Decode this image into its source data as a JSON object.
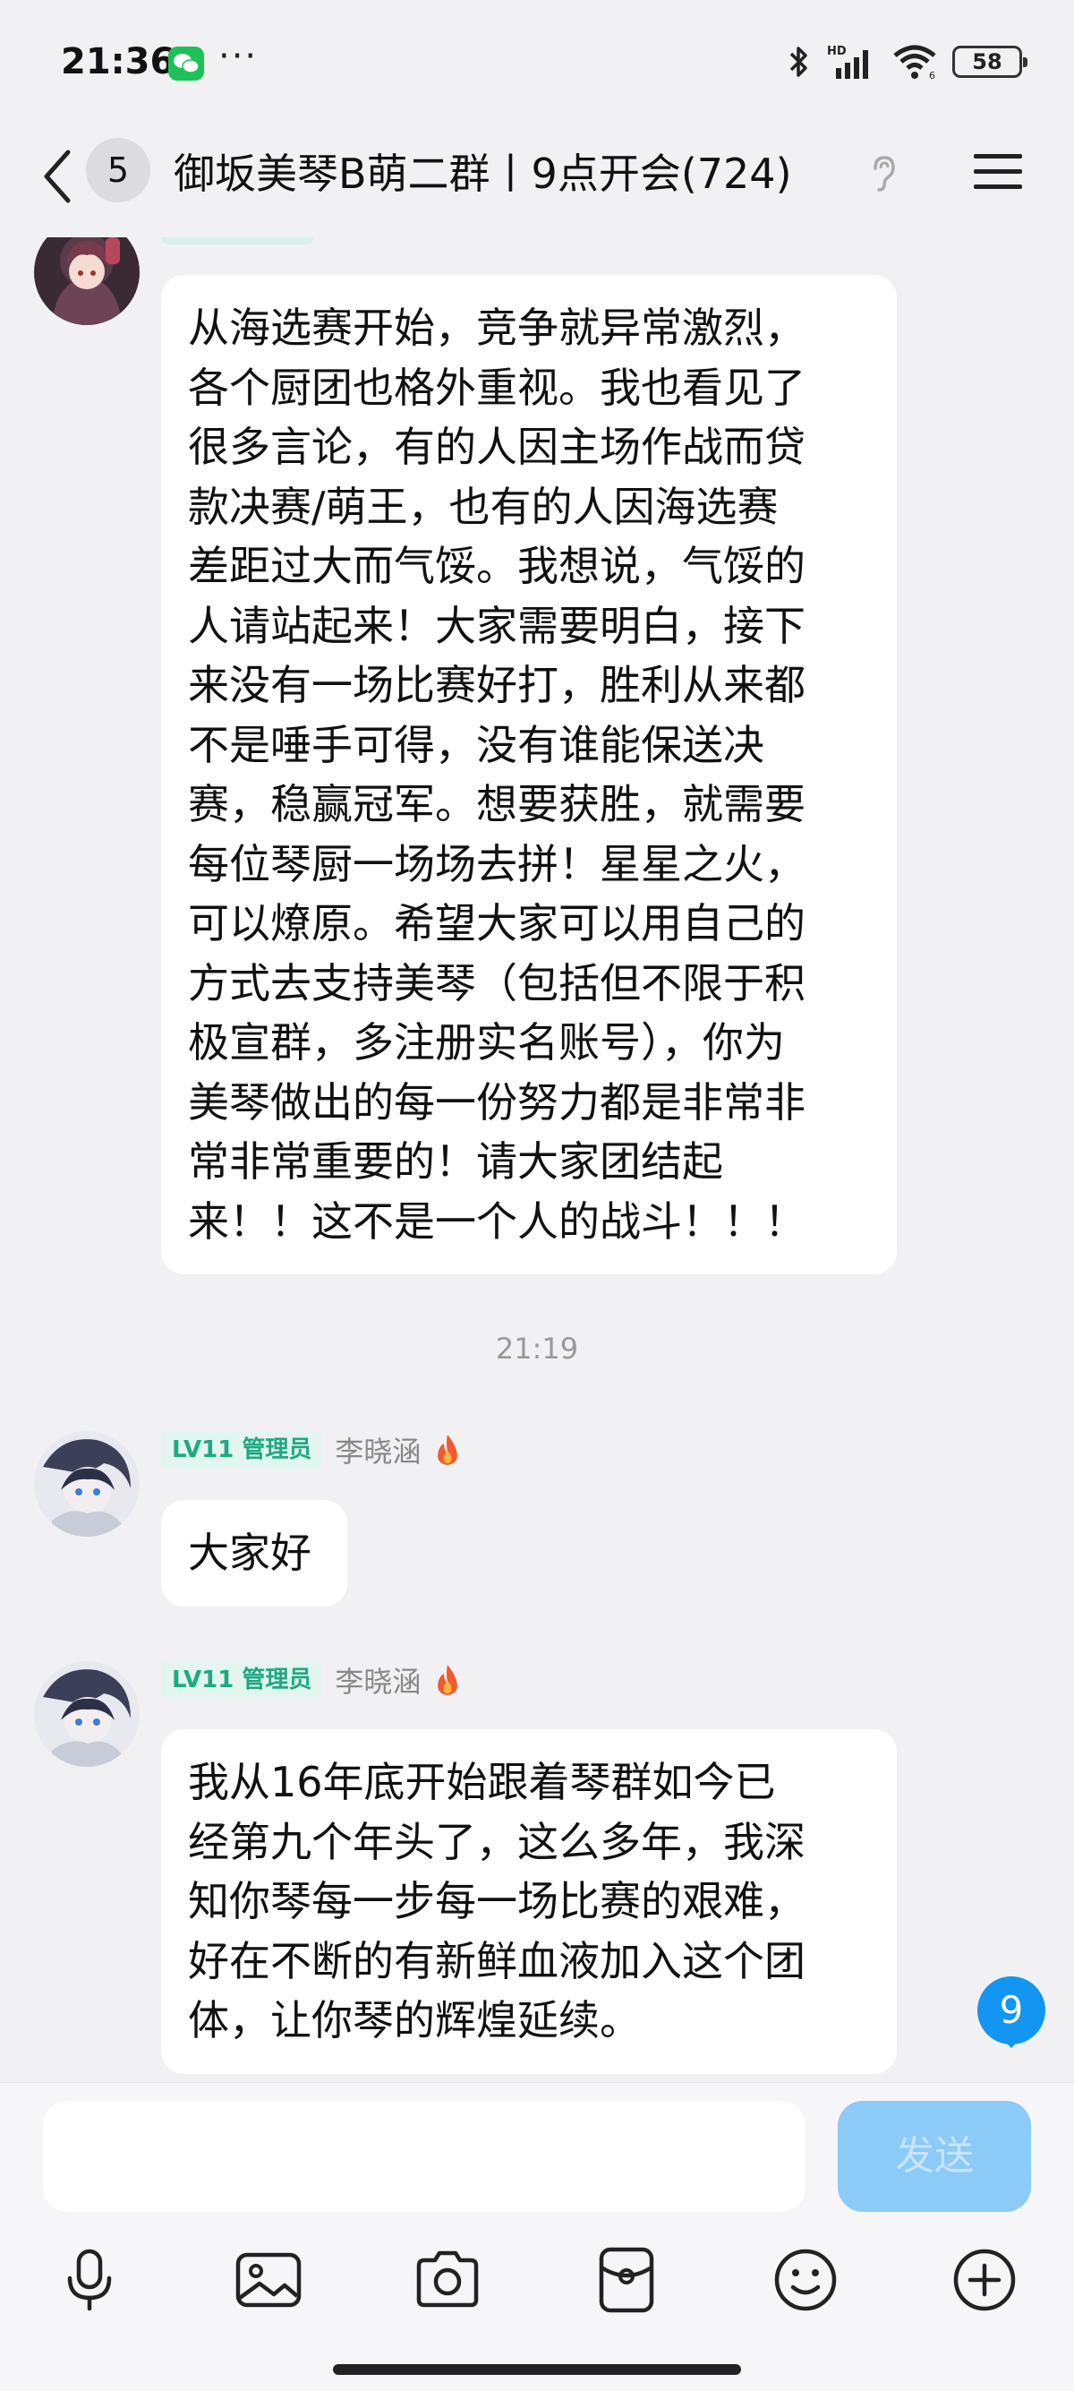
{
  "status": {
    "time": "21:36",
    "more": "···",
    "battery": "58"
  },
  "header": {
    "unread": "5",
    "title": "御坂美琴B萌二群丨9点开会(724)"
  },
  "messages": [
    {
      "text": "从海选赛开始，竞争就异常激烈，\n各个厨团也格外重视。我也看见了\n很多言论，有的人因主场作战而贷\n款决赛/萌王，也有的人因海选赛\n差距过大而气馁。我想说，气馁的\n人请站起来！大家需要明白，接下\n来没有一场比赛好打，胜利从来都\n不是唾手可得，没有谁能保送决\n赛，稳赢冠军。想要获胜，就需要\n每位琴厨一场场去拼！星星之火，\n可以燎原。希望大家可以用自己的\n方式去支持美琴（包括但不限于积\n极宣群，多注册实名账号），你为\n美琴做出的每一份努力都是非常非\n常非常重要的！请大家团结起\n来！！这不是一个人的战斗！！！"
    },
    {
      "level": "LV11 管理员",
      "sender": "李晓涵",
      "text": "大家好"
    },
    {
      "level": "LV11 管理员",
      "sender": "李晓涵",
      "text": "我从16年底开始跟着琴群如今已\n经第九个年头了，这么多年，我深\n知你琴每一步每一场比赛的艰难，\n好在不断的有新鲜血液加入这个团\n体，让你琴的辉煌延续。"
    }
  ],
  "timestamp": "21:19",
  "floating_badge": "9",
  "composer": {
    "placeholder": "",
    "send_label": "发送"
  },
  "icons": {
    "back": "chevron-left-icon",
    "ear": "ear-icon",
    "menu": "hamburger-menu-icon",
    "fire": "fire-icon",
    "toolbar": [
      "microphone-icon",
      "image-icon",
      "camera-icon",
      "red-packet-icon",
      "emoji-icon",
      "plus-icon"
    ]
  },
  "colors": {
    "send_button": "#8ccaf7",
    "level_badge_text": "#1ea982",
    "level_badge_bg": "#e3f5ef",
    "badge_blue": "#1296f2",
    "fire": "#f35a2b"
  }
}
